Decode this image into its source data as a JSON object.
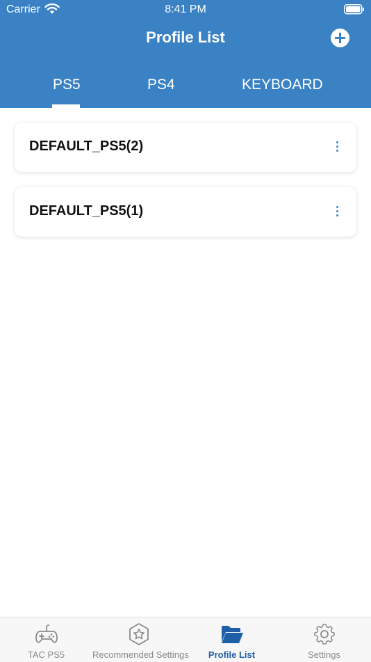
{
  "status_bar": {
    "carrier": "Carrier",
    "time": "8:41 PM"
  },
  "header": {
    "title": "Profile List",
    "add_icon": "plus-circle-icon"
  },
  "tabs": [
    {
      "label": "PS5",
      "selected": true
    },
    {
      "label": "PS4",
      "selected": false
    },
    {
      "label": "KEYBOARD",
      "selected": false
    }
  ],
  "profiles": [
    {
      "name": "DEFAULT_PS5(2)"
    },
    {
      "name": "DEFAULT_PS5(1)"
    }
  ],
  "tab_bar": [
    {
      "label": "TAC PS5",
      "icon": "gamepad-icon",
      "active": false
    },
    {
      "label": "Recommended Settings",
      "icon": "star-badge-icon",
      "active": false
    },
    {
      "label": "Profile List",
      "icon": "folder-open-icon",
      "active": true
    },
    {
      "label": "Settings",
      "icon": "gear-icon",
      "active": false
    }
  ],
  "colors": {
    "primary": "#3a82c4",
    "active_tab": "#1f5fa8",
    "inactive_tab": "#8a8a8a"
  }
}
